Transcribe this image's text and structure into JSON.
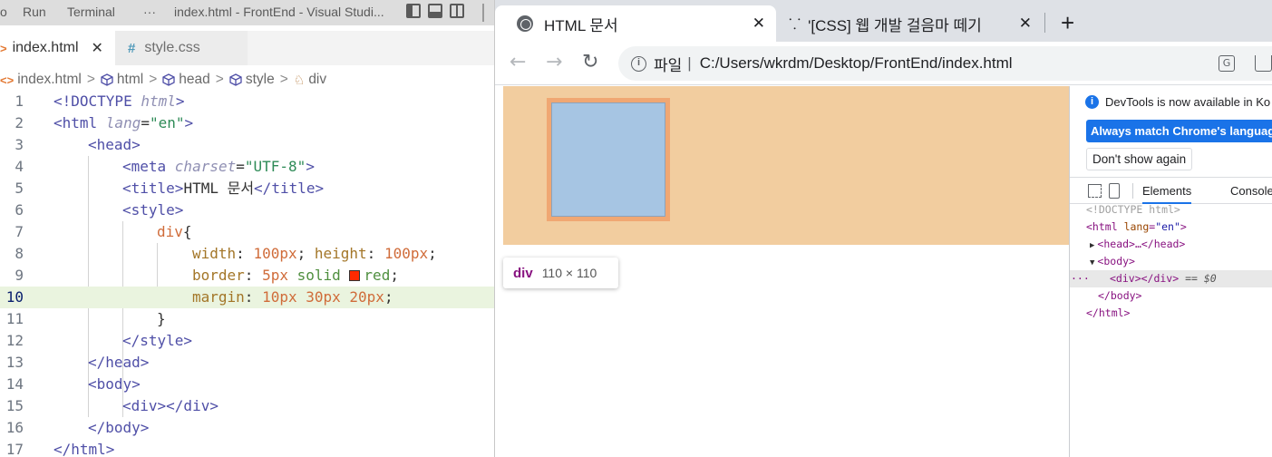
{
  "vscode": {
    "titlebar": {
      "menu_partial": "o",
      "menu_run": "Run",
      "menu_terminal": "Terminal",
      "more": "···",
      "title": "index.html - FrontEnd - Visual Studi..."
    },
    "tabs": [
      {
        "label": "index.html",
        "close": "✕"
      },
      {
        "label": "style.css"
      }
    ],
    "breadcrumb": [
      "index.html",
      "html",
      "head",
      "style",
      "div"
    ],
    "current_line": 10,
    "lines": [
      {
        "n": "1",
        "text": "<!DOCTYPE html>"
      },
      {
        "n": "2",
        "text": "<html lang=\"en\">"
      },
      {
        "n": "3",
        "text": "<head>"
      },
      {
        "n": "4",
        "text": "<meta charset=\"UTF-8\">"
      },
      {
        "n": "5",
        "text": "<title>HTML 문서</title>"
      },
      {
        "n": "6",
        "text": "<style>"
      },
      {
        "n": "7",
        "text": "div{"
      },
      {
        "n": "8",
        "text": "width: 100px; height: 100px;"
      },
      {
        "n": "9",
        "text": "border: 5px solid red;"
      },
      {
        "n": "10",
        "text": "margin: 10px 30px 20px;"
      },
      {
        "n": "11",
        "text": "}"
      },
      {
        "n": "12",
        "text": "</style>"
      },
      {
        "n": "13",
        "text": "</head>"
      },
      {
        "n": "14",
        "text": "<body>"
      },
      {
        "n": "15",
        "text": "<div></div>"
      },
      {
        "n": "16",
        "text": "</body>"
      },
      {
        "n": "17",
        "text": "</html>"
      }
    ],
    "swatch_color": "#ff2a00"
  },
  "chrome": {
    "tabs": [
      {
        "title": "HTML 문서",
        "close": "✕"
      },
      {
        "title": "'[CSS] 웹 개발 걸음마 떼기",
        "close": "✕"
      }
    ],
    "new_tab": "+",
    "omnibox": {
      "scheme_label": "파일",
      "separator": "|",
      "url": "C:/Users/wkrdm/Desktop/FrontEnd/index.html"
    },
    "tooltip": {
      "tag": "div",
      "size": "110 × 110"
    },
    "colors": {
      "margin": "#f2cd9f",
      "border": "#f0a773",
      "content": "#a6c5e3",
      "accent": "#1a73e8"
    }
  },
  "devtools": {
    "banner": "DevTools is now available in Ko",
    "match_button": "Always match Chrome's language",
    "dont_show_button": "Don't show again",
    "tabs": [
      "Elements",
      "Console"
    ],
    "tree": {
      "doctype": "<!DOCTYPE html>",
      "html_open_tag": "<html",
      "html_attr": "lang",
      "html_val": "\"en\"",
      "html_close_bracket": ">",
      "head": "<head>…</head>",
      "body_open": "<body>",
      "div": "<div></div>",
      "selected_marker": "== $0",
      "body_close": "</body>",
      "html_close": "</html>",
      "ellipsis": "···"
    }
  }
}
